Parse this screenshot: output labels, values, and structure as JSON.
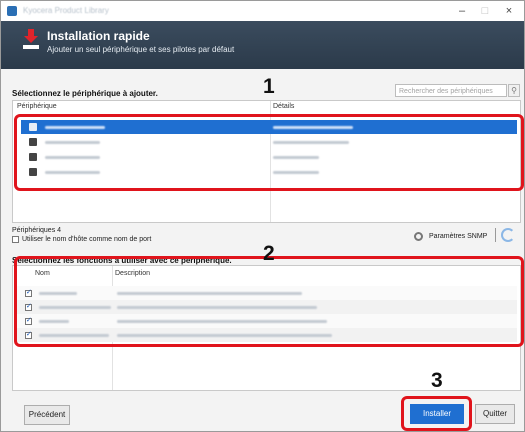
{
  "window": {
    "title": "Kyocera Product Library",
    "minimize": "–",
    "maximize": "□",
    "close": "×"
  },
  "banner": {
    "title": "Installation rapide",
    "subtitle": "Ajouter un seul périphérique et ses pilotes par défaut"
  },
  "devices_section": {
    "label": "Sélectionnez le périphérique à ajouter.",
    "search_placeholder": "Rechercher des périphériques",
    "columns": [
      "Périphérique",
      "Détails"
    ],
    "count_label": "Périphériques 4",
    "hostname_checkbox_label": "Utiliser le nom d'hôte comme nom de port",
    "snmp_label": "Paramètres SNMP"
  },
  "functions_section": {
    "label": "Sélectionnez les fonctions à utiliser avec ce périphérique.",
    "columns": [
      "Nom",
      "Description"
    ]
  },
  "footer": {
    "back": "Précédent",
    "install": "Installer",
    "quit": "Quitter"
  },
  "callouts": [
    "1",
    "2",
    "3"
  ],
  "colors": {
    "callout": "#e0141c",
    "selection": "#1f6fd1",
    "banner": "#344556"
  }
}
